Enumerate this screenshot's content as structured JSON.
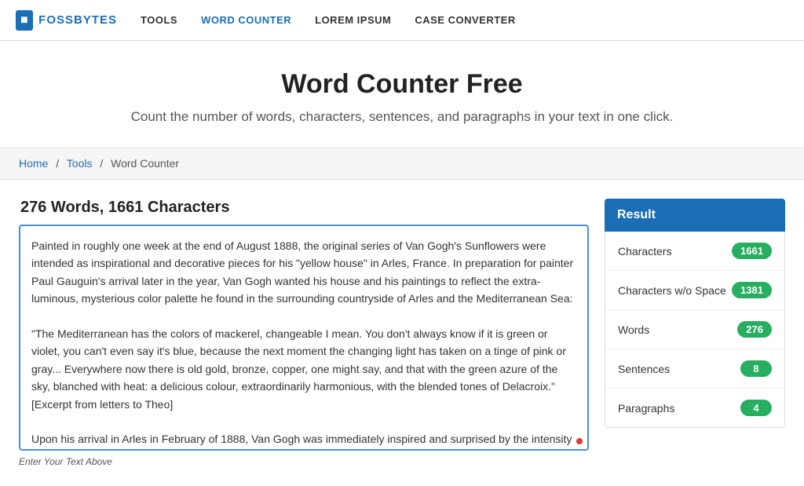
{
  "nav": {
    "logo_text": "FOSSBYTES",
    "logo_icon": "F",
    "links": [
      {
        "label": "TOOLS",
        "active": false
      },
      {
        "label": "WORD COUNTER",
        "active": true
      },
      {
        "label": "LOREM IPSUM",
        "active": false
      },
      {
        "label": "CASE CONVERTER",
        "active": false
      }
    ]
  },
  "hero": {
    "title": "Word Counter Free",
    "subtitle": "Count the number of words, characters, sentences, and paragraphs in your text in one click."
  },
  "breadcrumb": {
    "home": "Home",
    "tools": "Tools",
    "current": "Word Counter"
  },
  "editor": {
    "word_count_header": "276 Words, 1661 Characters",
    "placeholder": "Enter Your Text Above",
    "hint": "Enter Your Text Above",
    "content": "Painted in roughly one week at the end of August 1888, the original series of Van Gogh's Sunflowers were intended as inspirational and decorative pieces for his \"yellow house\" in Arles, France. In preparation for painter Paul Gauguin's arrival later in the year, Van Gogh wanted his house and his paintings to reflect the extra-luminous, mysterious color palette he found in the surrounding countryside of Arles and the Mediterranean Sea:\n\n\"The Mediterranean has the colors of mackerel, changeable I mean. You don't always know if it is green or violet, you can't even say it's blue, because the next moment the changing light has taken on a tinge of pink or gray... Everywhere now there is old gold, bronze, copper, one might say, and that with the green azure of the sky, blanched with heat: a delicious colour, extraordinarily harmonious, with the blended tones of Delacroix.\" [Excerpt from letters to Theo]\n\nUpon his arrival in Arles in February of 1888, Van Gogh was immediately inspired and surprised by the intensity"
  },
  "results": {
    "header": "Result",
    "rows": [
      {
        "label": "Characters",
        "value": "1661"
      },
      {
        "label": "Characters w/o Space",
        "value": "1381"
      },
      {
        "label": "Words",
        "value": "276"
      },
      {
        "label": "Sentences",
        "value": "8"
      },
      {
        "label": "Paragraphs",
        "value": "4"
      }
    ]
  }
}
